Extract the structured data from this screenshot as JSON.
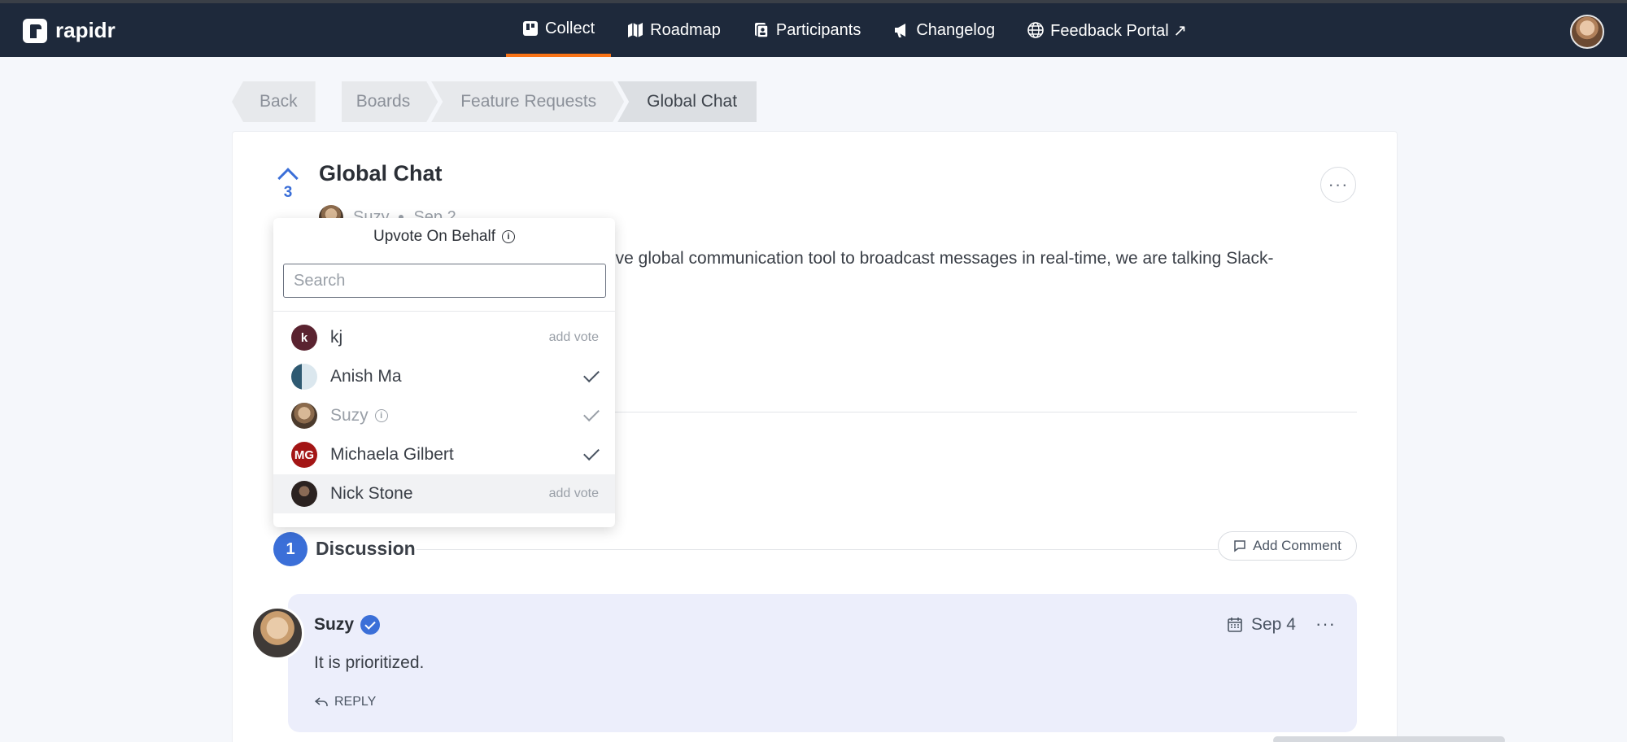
{
  "app": {
    "brand": "rapidr"
  },
  "nav": {
    "items": [
      {
        "label": "Collect",
        "icon": "board-icon",
        "active": true
      },
      {
        "label": "Roadmap",
        "icon": "map-icon",
        "active": false
      },
      {
        "label": "Participants",
        "icon": "people-icon",
        "active": false
      },
      {
        "label": "Changelog",
        "icon": "megaphone-icon",
        "active": false
      },
      {
        "label": "Feedback Portal ↗",
        "icon": "globe-icon",
        "active": false
      }
    ]
  },
  "breadcrumb": {
    "back": "Back",
    "items": [
      "Boards",
      "Feature Requests",
      "Global Chat"
    ]
  },
  "post": {
    "title": "Global Chat",
    "votes": "3",
    "author": "Suzy",
    "date": "Sep 2",
    "description_visible": "ive global communication tool to broadcast messages in real-time, we are talking Slack-"
  },
  "popover": {
    "title": "Upvote On Behalf",
    "search_placeholder": "Search",
    "users": [
      {
        "initials": "k",
        "name": "kj",
        "action": "add vote",
        "state": "none"
      },
      {
        "initials": "",
        "name": "Anish Ma",
        "action": "",
        "state": "checked"
      },
      {
        "initials": "",
        "name": "Suzy",
        "action": "",
        "state": "checked-muted"
      },
      {
        "initials": "MG",
        "name": "Michaela Gilbert",
        "action": "",
        "state": "checked"
      },
      {
        "initials": "",
        "name": "Nick Stone",
        "action": "add vote",
        "state": "none"
      }
    ]
  },
  "discussion": {
    "count": "1",
    "title": "Discussion",
    "add_comment": "Add Comment",
    "comment": {
      "author": "Suzy",
      "date": "Sep 4",
      "text": "It is prioritized.",
      "reply": "REPLY"
    }
  },
  "colors": {
    "topbar": "#1e293b",
    "accent": "#3b6fd8",
    "active_tab_underline": "#f97316",
    "comment_bg": "#eceefb"
  }
}
